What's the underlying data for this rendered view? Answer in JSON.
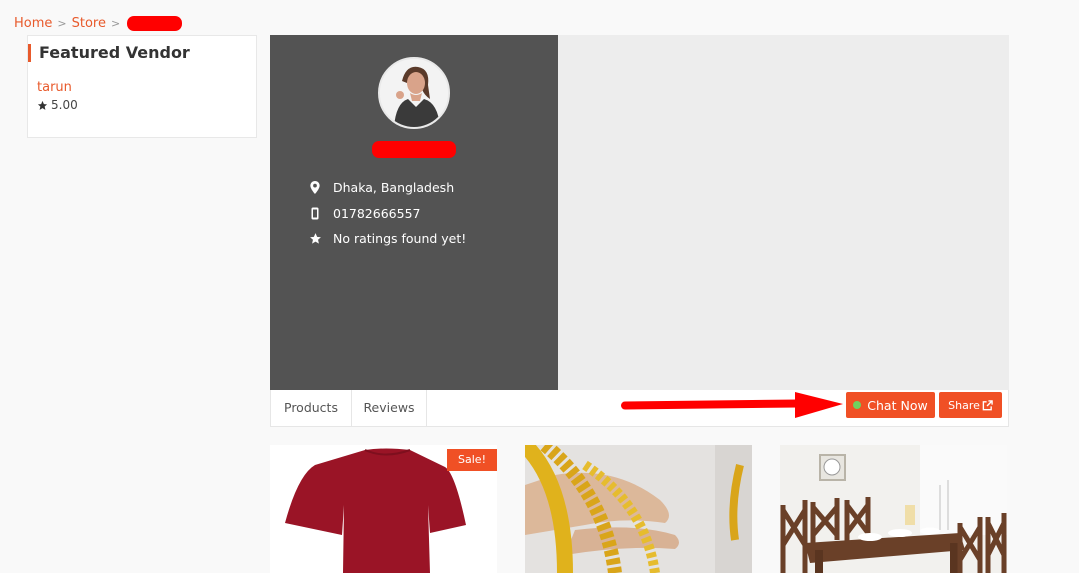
{
  "breadcrumb": {
    "items": [
      {
        "label": "Home"
      },
      {
        "label": "Store"
      }
    ],
    "current_redacted": true
  },
  "sidebar": {
    "widget_title": "Featured Vendor",
    "vendors": [
      {
        "name": "tarun",
        "rating": "5.00"
      }
    ]
  },
  "store": {
    "name_redacted": true,
    "address": "Dhaka, Bangladesh",
    "phone": "01782666557",
    "rating_text": "No ratings found yet!",
    "icons": {
      "address": "map-marker-icon",
      "phone": "mobile-phone-icon",
      "rating": "star-icon"
    }
  },
  "tabs": [
    {
      "label": "Products"
    },
    {
      "label": "Reviews"
    }
  ],
  "actions": {
    "chat_label": "Chat Now",
    "chat_status": "online",
    "share_label": "Share"
  },
  "products": [
    {
      "image": "red t-shirt",
      "badge": "Sale!"
    },
    {
      "image": "gold chains on mannequin hand",
      "badge": null
    },
    {
      "image": "dining table with chairs",
      "badge": null
    }
  ],
  "colors": {
    "accent": "#f05025",
    "link": "#e85a2c",
    "store_panel": "#535353",
    "online": "#6ed15f",
    "annotation_arrow": "#ff0000"
  }
}
